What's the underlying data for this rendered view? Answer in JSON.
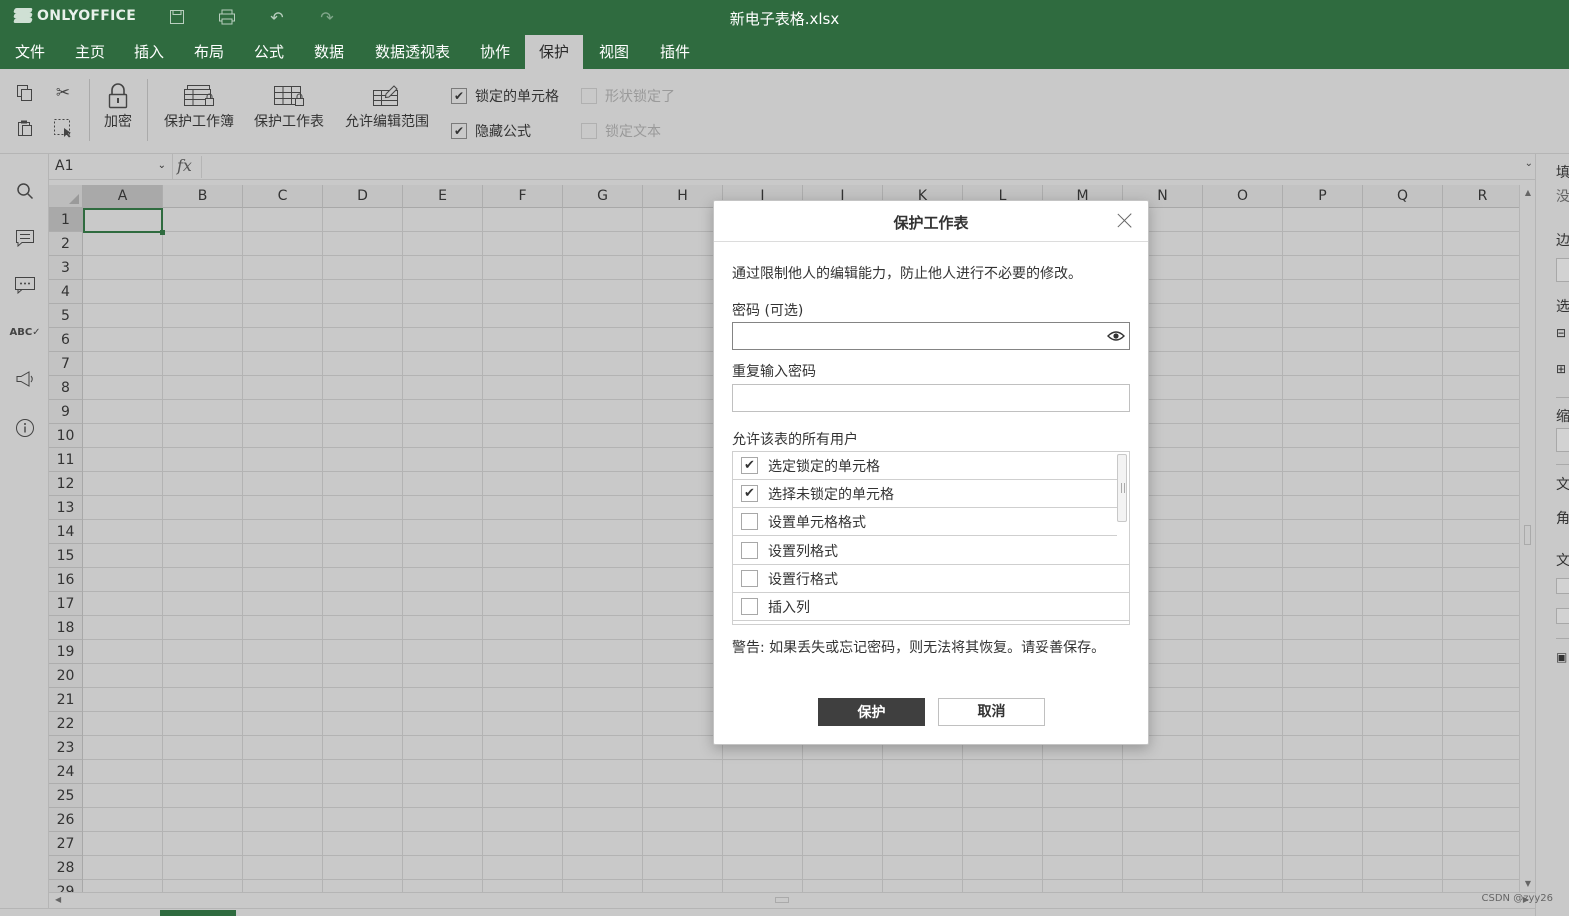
{
  "app": {
    "logo": "ONLYOFFICE",
    "document_title": "新电子表格.xlsx"
  },
  "menu": {
    "tabs": [
      "文件",
      "主页",
      "插入",
      "布局",
      "公式",
      "数据",
      "数据透视表",
      "协作",
      "保护",
      "视图",
      "插件"
    ],
    "active": "保护"
  },
  "toolbar": {
    "encrypt": "加密",
    "protect_workbook": "保护工作簿",
    "protect_sheet": "保护工作表",
    "allow_edit_ranges": "允许编辑范围",
    "locked_cell": {
      "label": "锁定的单元格",
      "checked": true
    },
    "hidden_formulas": {
      "label": "隐藏公式",
      "checked": true
    },
    "shape_locked": {
      "label": "形状锁定了",
      "checked": false,
      "disabled": true
    },
    "lock_text": {
      "label": "锁定文本",
      "checked": false,
      "disabled": true
    }
  },
  "formula_bar": {
    "cell_ref": "A1",
    "fx": "fx",
    "value": ""
  },
  "grid": {
    "columns": [
      "A",
      "B",
      "C",
      "D",
      "E",
      "F",
      "G",
      "H",
      "I",
      "J",
      "K",
      "L",
      "M",
      "N",
      "O",
      "P",
      "Q",
      "R"
    ],
    "rows": [
      "1",
      "2",
      "3",
      "4",
      "5",
      "6",
      "7",
      "8",
      "9",
      "10",
      "11",
      "12",
      "13",
      "14",
      "15",
      "16",
      "17",
      "18",
      "19",
      "20",
      "21",
      "22",
      "23",
      "24",
      "25",
      "26",
      "27",
      "28",
      "29"
    ],
    "selected_cell": "A1"
  },
  "right_panel": {
    "labels": [
      "填",
      "边",
      "选",
      "缩",
      "文",
      "角",
      "文"
    ],
    "value_fragment": "没"
  },
  "dialog": {
    "title": "保护工作表",
    "description": "通过限制他人的编辑能力，防止他人进行不必要的修改。",
    "password_label": "密码 (可选)",
    "password_value": "",
    "repeat_label": "重复输入密码",
    "repeat_value": "",
    "allow_label": "允许该表的所有用户",
    "permissions": [
      {
        "label": "选定锁定的单元格",
        "checked": true
      },
      {
        "label": "选择未锁定的单元格",
        "checked": true
      },
      {
        "label": "设置单元格格式",
        "checked": false
      },
      {
        "label": "设置列格式",
        "checked": false
      },
      {
        "label": "设置行格式",
        "checked": false
      },
      {
        "label": "插入列",
        "checked": false
      }
    ],
    "warning": "警告: 如果丢失或忘记密码，则无法将其恢复。请妥善保存。",
    "ok_label": "保护",
    "cancel_label": "取消",
    "check_mark": "✔"
  },
  "watermark": "CSDN @zyy26"
}
